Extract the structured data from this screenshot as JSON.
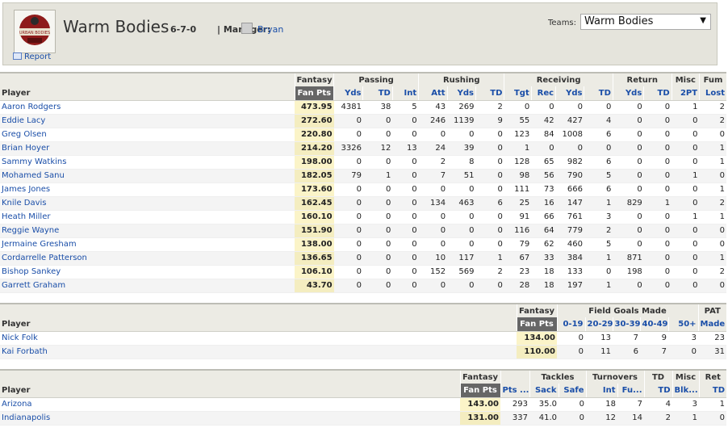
{
  "header": {
    "team_name": "Warm Bodies",
    "record": "6-7-0",
    "manager_label": "| Manager:",
    "manager_name": "Bryan",
    "report_label": "Report",
    "teams_label": "Teams:",
    "teams_selected": "Warm Bodies",
    "logo_text": "URBAN BODIES"
  },
  "offense": {
    "groups": [
      "Fantasy",
      "Passing",
      "Rushing",
      "Receiving",
      "Return",
      "Misc",
      "Fum"
    ],
    "columns": [
      "Player",
      "Fan Pts",
      "Yds",
      "TD",
      "Int",
      "Att",
      "Yds",
      "TD",
      "Tgt",
      "Rec",
      "Yds",
      "TD",
      "Yds",
      "TD",
      "2PT",
      "Lost"
    ],
    "rows": [
      [
        "Aaron Rodgers",
        "473.95",
        "4381",
        "38",
        "5",
        "43",
        "269",
        "2",
        "0",
        "0",
        "0",
        "0",
        "0",
        "0",
        "1",
        "2"
      ],
      [
        "Eddie Lacy",
        "272.60",
        "0",
        "0",
        "0",
        "246",
        "1139",
        "9",
        "55",
        "42",
        "427",
        "4",
        "0",
        "0",
        "0",
        "2"
      ],
      [
        "Greg Olsen",
        "220.80",
        "0",
        "0",
        "0",
        "0",
        "0",
        "0",
        "123",
        "84",
        "1008",
        "6",
        "0",
        "0",
        "0",
        "0"
      ],
      [
        "Brian Hoyer",
        "214.20",
        "3326",
        "12",
        "13",
        "24",
        "39",
        "0",
        "1",
        "0",
        "0",
        "0",
        "0",
        "0",
        "0",
        "1"
      ],
      [
        "Sammy Watkins",
        "198.00",
        "0",
        "0",
        "0",
        "2",
        "8",
        "0",
        "128",
        "65",
        "982",
        "6",
        "0",
        "0",
        "0",
        "1"
      ],
      [
        "Mohamed Sanu",
        "182.05",
        "79",
        "1",
        "0",
        "7",
        "51",
        "0",
        "98",
        "56",
        "790",
        "5",
        "0",
        "0",
        "1",
        "0"
      ],
      [
        "James Jones",
        "173.60",
        "0",
        "0",
        "0",
        "0",
        "0",
        "0",
        "111",
        "73",
        "666",
        "6",
        "0",
        "0",
        "0",
        "1"
      ],
      [
        "Knile Davis",
        "162.45",
        "0",
        "0",
        "0",
        "134",
        "463",
        "6",
        "25",
        "16",
        "147",
        "1",
        "829",
        "1",
        "0",
        "2"
      ],
      [
        "Heath Miller",
        "160.10",
        "0",
        "0",
        "0",
        "0",
        "0",
        "0",
        "91",
        "66",
        "761",
        "3",
        "0",
        "0",
        "1",
        "1"
      ],
      [
        "Reggie Wayne",
        "151.90",
        "0",
        "0",
        "0",
        "0",
        "0",
        "0",
        "116",
        "64",
        "779",
        "2",
        "0",
        "0",
        "0",
        "0"
      ],
      [
        "Jermaine Gresham",
        "138.00",
        "0",
        "0",
        "0",
        "0",
        "0",
        "0",
        "79",
        "62",
        "460",
        "5",
        "0",
        "0",
        "0",
        "0"
      ],
      [
        "Cordarrelle Patterson",
        "136.65",
        "0",
        "0",
        "0",
        "10",
        "117",
        "1",
        "67",
        "33",
        "384",
        "1",
        "871",
        "0",
        "0",
        "1"
      ],
      [
        "Bishop Sankey",
        "106.10",
        "0",
        "0",
        "0",
        "152",
        "569",
        "2",
        "23",
        "18",
        "133",
        "0",
        "198",
        "0",
        "0",
        "2"
      ],
      [
        "Garrett Graham",
        "43.70",
        "0",
        "0",
        "0",
        "0",
        "0",
        "0",
        "28",
        "18",
        "197",
        "1",
        "0",
        "0",
        "0",
        "0"
      ]
    ]
  },
  "kickers": {
    "groups": [
      "Fantasy",
      "Field Goals Made",
      "PAT"
    ],
    "columns": [
      "Player",
      "Fan Pts",
      "0-19",
      "20-29",
      "30-39",
      "40-49",
      "50+",
      "Made"
    ],
    "rows": [
      [
        "Nick Folk",
        "134.00",
        "0",
        "13",
        "7",
        "9",
        "3",
        "23"
      ],
      [
        "Kai Forbath",
        "110.00",
        "0",
        "11",
        "6",
        "7",
        "0",
        "31"
      ]
    ]
  },
  "defense": {
    "groups": [
      "Fantasy",
      "Tackles",
      "Turnovers",
      "TD",
      "Misc",
      "Ret"
    ],
    "columns": [
      "Player",
      "Fan Pts",
      "Pts ...",
      "Sack",
      "Safe",
      "Int",
      "Fu...",
      "TD",
      "Blk...",
      "TD"
    ],
    "rows": [
      [
        "Arizona",
        "143.00",
        "293",
        "35.0",
        "0",
        "18",
        "7",
        "4",
        "3",
        "1"
      ],
      [
        "Indianapolis",
        "131.00",
        "337",
        "41.0",
        "0",
        "12",
        "14",
        "2",
        "1",
        "0"
      ]
    ]
  }
}
